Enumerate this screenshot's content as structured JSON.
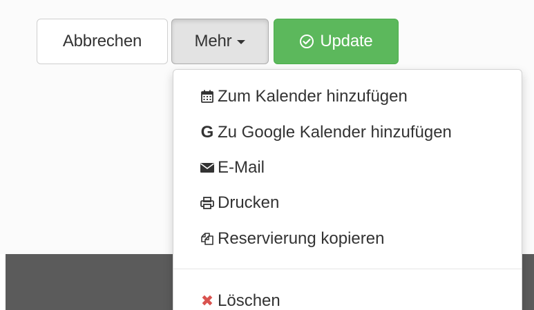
{
  "toolbar": {
    "cancel_label": "Abbrechen",
    "more_label": "Mehr",
    "update_label": "Update"
  },
  "menu": {
    "items": [
      {
        "label": "Zum Kalender hinzufügen",
        "icon": "calendar-icon"
      },
      {
        "label": "Zu Google Kalender hinzufügen",
        "icon": "google-icon"
      },
      {
        "label": "E-Mail",
        "icon": "envelope-icon"
      },
      {
        "label": "Drucken",
        "icon": "print-icon"
      },
      {
        "label": "Reservierung kopieren",
        "icon": "copy-icon"
      }
    ],
    "delete_label": "Löschen",
    "delete_icon": "delete-x-icon"
  },
  "colors": {
    "update_green": "#5cb85c",
    "delete_red": "#d9534f",
    "bottom_bar": "#5b5b5b"
  }
}
